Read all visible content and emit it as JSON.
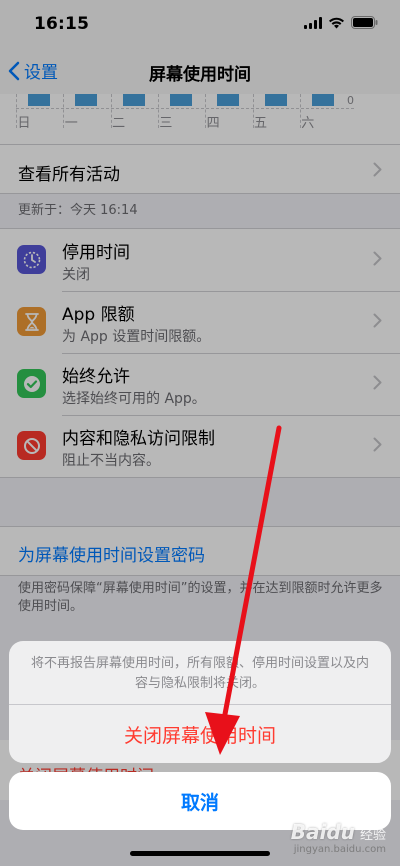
{
  "status_bar": {
    "time": "16:15"
  },
  "nav": {
    "back_label": "设置",
    "title": "屏幕使用时间"
  },
  "chart": {
    "zero_label": "0",
    "days": [
      "日",
      "一",
      "二",
      "三",
      "四",
      "五",
      "六"
    ]
  },
  "activity": {
    "see_all_label": "查看所有活动",
    "updated_text": "更新于：今天 16:14"
  },
  "settings": [
    {
      "title": "停用时间",
      "subtitle": "关闭",
      "icon": "downtime-icon",
      "color": "#5856d6"
    },
    {
      "title": "App 限额",
      "subtitle": "为 App 设置时间限额。",
      "icon": "hourglass-icon",
      "color": "#f09a37"
    },
    {
      "title": "始终允许",
      "subtitle": "选择始终可用的 App。",
      "icon": "checkmark-seal-icon",
      "color": "#34c759"
    },
    {
      "title": "内容和隐私访问限制",
      "subtitle": "阻止不当内容。",
      "icon": "restriction-icon",
      "color": "#ff3b30"
    }
  ],
  "passcode": {
    "label": "为屏幕使用时间设置密码",
    "footer": "使用密码保障“屏幕使用时间”的设置，并在达到限额时允许更多使用时间。"
  },
  "behind": {
    "label": "关闭屏幕使用时间"
  },
  "action_sheet": {
    "message": "将不再报告屏幕使用时间，所有限额、停用时间设置以及内容与隐私限制将关闭。",
    "destructive_label": "关闭屏幕使用时间",
    "cancel_label": "取消"
  },
  "colors": {
    "accent": "#007aff",
    "destructive": "#ff3b30",
    "arrow": "#e8101a"
  },
  "watermark": {
    "brand": "Baidu",
    "jingyan": "经验",
    "url": "jingyan.baidu.com"
  }
}
